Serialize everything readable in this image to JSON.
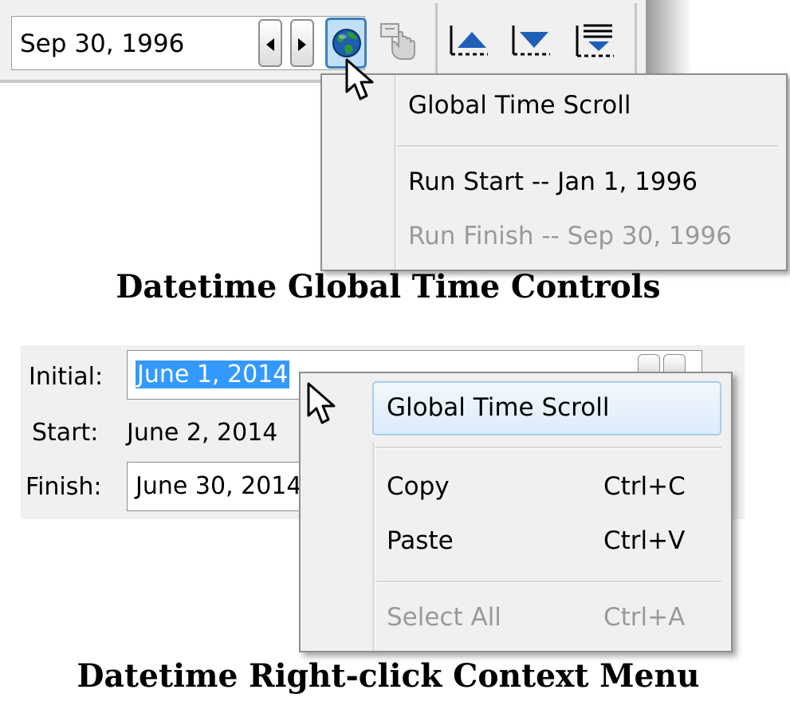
{
  "toolbar": {
    "date_value": "Sep 30, 1996"
  },
  "global_menu": {
    "items": [
      {
        "label": "Global Time Scroll",
        "enabled": true
      },
      {
        "label": "Run Start -- Jan 1, 1996",
        "enabled": true
      },
      {
        "label": "Run Finish -- Sep 30, 1996",
        "enabled": false
      }
    ]
  },
  "captions": {
    "top": "Datetime Global Time Controls",
    "bottom": "Datetime Right-click Context Menu"
  },
  "form": {
    "initial_label": "Initial:",
    "initial_value": "June 1, 2014",
    "start_label": "Start:",
    "start_value": "June 2, 2014",
    "finish_label": "Finish:",
    "finish_value": "June 30, 2014"
  },
  "context_menu": {
    "items": [
      {
        "label": "Global Time Scroll",
        "shortcut": "",
        "enabled": true
      },
      {
        "label": "Copy",
        "shortcut": "Ctrl+C",
        "enabled": true
      },
      {
        "label": "Paste",
        "shortcut": "Ctrl+V",
        "enabled": true
      },
      {
        "label": "Select All",
        "shortcut": "Ctrl+A",
        "enabled": false
      }
    ]
  },
  "icons": {
    "prev": "arrow-left-icon",
    "next": "arrow-right-icon",
    "globe": "globe-icon",
    "calendar_hand": "calendar-hand-icon",
    "move_up": "move-up-icon",
    "move_down": "move-down-icon",
    "collapse_list": "list-down-icon",
    "cursor": "mouse-pointer-icon"
  },
  "colors": {
    "selection": "#3399ff",
    "hover_border": "#a7cdf0",
    "globe_button": "#bfe0f6",
    "disabled_text": "#9a9a9a"
  }
}
